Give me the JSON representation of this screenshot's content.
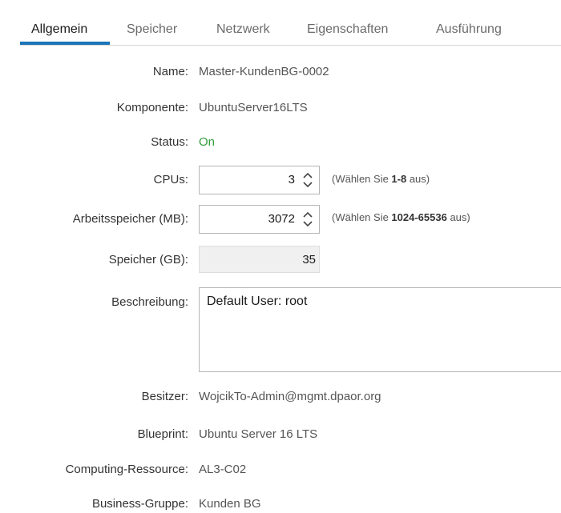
{
  "tabs": [
    {
      "label": "Allgemein",
      "active": true
    },
    {
      "label": "Speicher",
      "active": false
    },
    {
      "label": "Netzwerk",
      "active": false
    },
    {
      "label": "Eigenschaften",
      "active": false
    },
    {
      "label": "Ausführung",
      "active": false
    }
  ],
  "fields": {
    "name": {
      "label": "Name:",
      "value": "Master-KundenBG-0002"
    },
    "komponente": {
      "label": "Komponente:",
      "value": "UbuntuServer16LTS"
    },
    "status": {
      "label": "Status:",
      "value": "On",
      "color": "#2e9e3b"
    },
    "cpus": {
      "label": "CPUs:",
      "value": "3",
      "hint_prefix": "(Wählen Sie ",
      "hint_range": "1-8",
      "hint_suffix": " aus)"
    },
    "memory": {
      "label": "Arbeitsspeicher (MB):",
      "value": "3072",
      "hint_prefix": "(Wählen Sie ",
      "hint_range": "1024-65536",
      "hint_suffix": " aus)"
    },
    "storage": {
      "label": "Speicher (GB):",
      "value": "35"
    },
    "description": {
      "label": "Beschreibung:",
      "value": "Default User: root"
    },
    "owner": {
      "label": "Besitzer:",
      "value": "WojcikTo-Admin@mgmt.dpaor.org"
    },
    "blueprint": {
      "label": "Blueprint:",
      "value": "Ubuntu Server 16 LTS"
    },
    "computing": {
      "label": "Computing-Ressource:",
      "value": "AL3-C02"
    },
    "business_group": {
      "label": "Business-Gruppe:",
      "value": "Kunden BG"
    }
  },
  "colors": {
    "accent": "#1b75b8",
    "status_on": "#2e9e3b"
  },
  "icons": {
    "spinner": "up-down-chevron-icon"
  }
}
